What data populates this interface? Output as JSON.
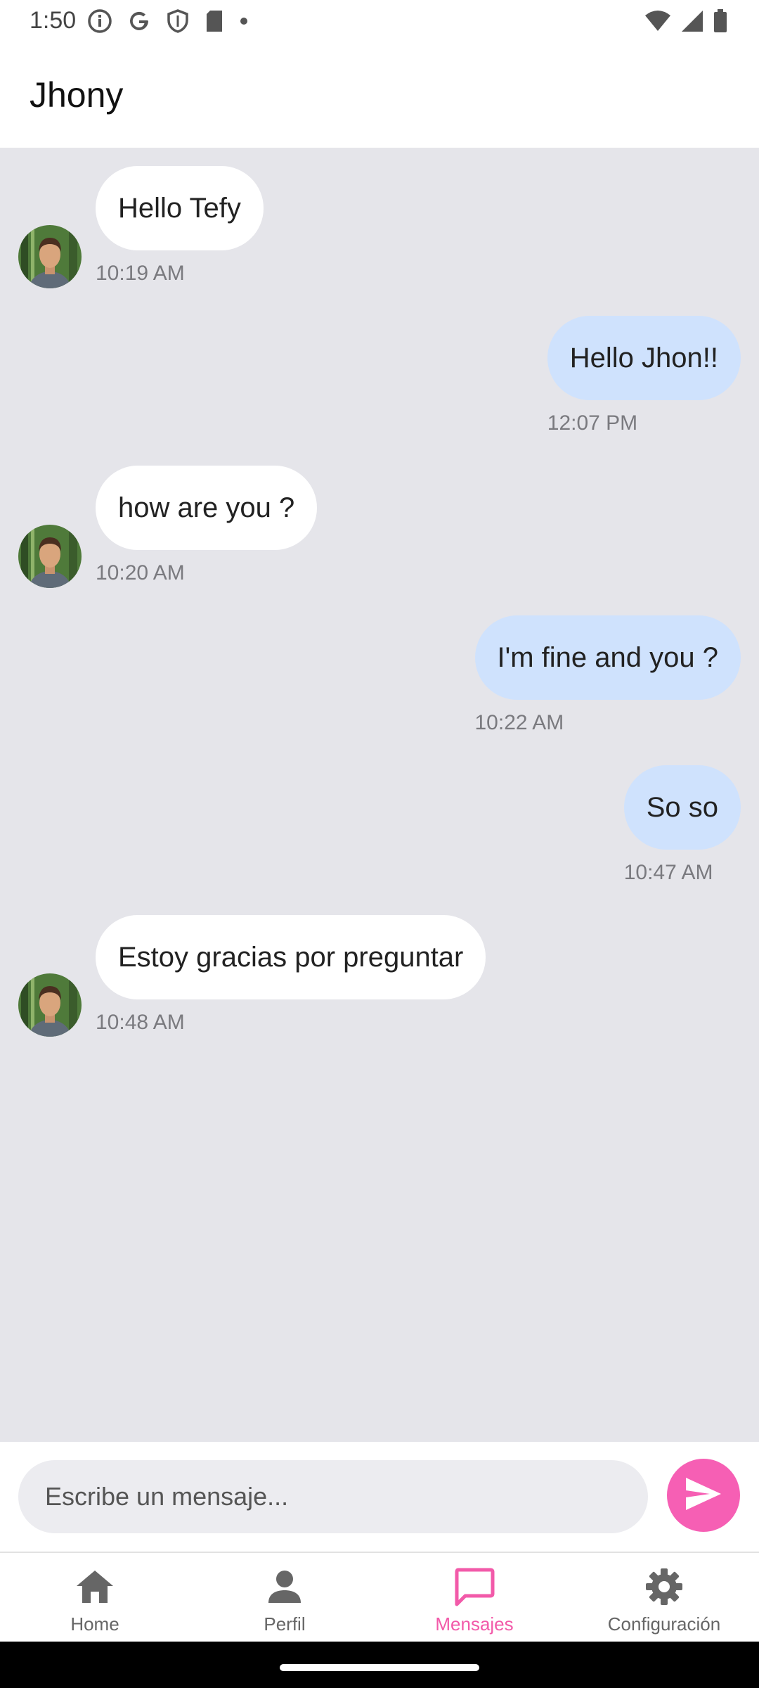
{
  "status_bar": {
    "time": "1:50",
    "left_icons": [
      "info-icon",
      "google-icon",
      "shield-icon",
      "sd-card-icon",
      "dot-icon"
    ],
    "right_icons": [
      "wifi-icon",
      "signal-icon",
      "battery-icon"
    ]
  },
  "header": {
    "title": "Jhony"
  },
  "chat": {
    "messages": [
      {
        "direction": "incoming",
        "text": "Hello Tefy",
        "time": "10:19 AM"
      },
      {
        "direction": "outgoing",
        "text": "Hello Jhon!!",
        "time": "12:07 PM"
      },
      {
        "direction": "incoming",
        "text": "how are you ?",
        "time": "10:20 AM"
      },
      {
        "direction": "outgoing",
        "text": "I'm fine and you ?",
        "time": "10:22 AM"
      },
      {
        "direction": "outgoing",
        "text": "So so",
        "time": "10:47 AM"
      },
      {
        "direction": "incoming",
        "text": "Estoy gracias por preguntar",
        "time": "10:48 AM"
      }
    ]
  },
  "composer": {
    "placeholder": "Escribe un mensaje...",
    "value": "",
    "send_icon": "send-icon"
  },
  "bottom_nav": {
    "items": [
      {
        "label": "Home",
        "icon": "home-icon",
        "active": false
      },
      {
        "label": "Perfil",
        "icon": "person-icon",
        "active": false
      },
      {
        "label": "Mensajes",
        "icon": "chat-bubble-icon",
        "active": true
      },
      {
        "label": "Configuración",
        "icon": "gear-icon",
        "active": false
      }
    ]
  },
  "colors": {
    "chat_background": "#e5e5ea",
    "incoming_bubble": "#ffffff",
    "outgoing_bubble": "#cfe2fd",
    "accent": "#f25aa9",
    "send_button": "#f65fb4"
  }
}
